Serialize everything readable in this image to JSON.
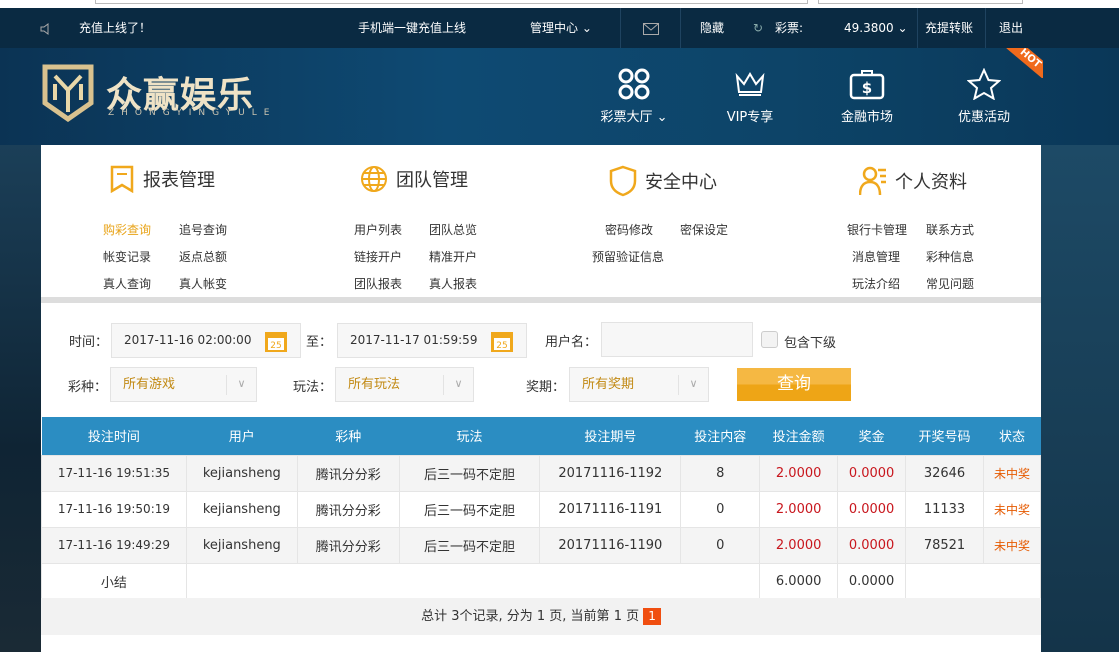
{
  "topbar": {
    "notice": "充值上线了！",
    "marquee": "手机端一键充值上线",
    "admin": "管理中心",
    "hide": "隐藏",
    "lottery_label": "彩票:",
    "balance": "49.3800",
    "transfer": "充提转账",
    "logout": "退出"
  },
  "header": {
    "logo_title": "众赢娱乐",
    "logo_sub": "ZHONGYINGYULE",
    "nav": [
      {
        "label": "彩票大厅"
      },
      {
        "label": "VIP专享"
      },
      {
        "label": "金融市场"
      },
      {
        "label": "优惠活动"
      }
    ],
    "hot_badge": "HOT"
  },
  "menu": {
    "categories": [
      {
        "title": "报表管理",
        "links": [
          "购彩查询",
          "追号查询",
          "帐变记录",
          "返点总额",
          "真人查询",
          "真人帐变"
        ]
      },
      {
        "title": "团队管理",
        "links": [
          "用户列表",
          "团队总览",
          "链接开户",
          "精准开户",
          "团队报表",
          "真人报表"
        ]
      },
      {
        "title": "安全中心",
        "links": [
          "密码修改",
          "密保设定",
          "预留验证信息"
        ]
      },
      {
        "title": "个人资料",
        "links": [
          "银行卡管理",
          "联系方式",
          "消息管理",
          "彩种信息",
          "玩法介绍",
          "常见问题"
        ]
      }
    ]
  },
  "filter": {
    "time_label": "时间：",
    "start": "2017-11-16 02:00:00",
    "to_label": "至：",
    "end": "2017-11-17 01:59:59",
    "cal_day": "25",
    "user_label": "用户名：",
    "username": "",
    "include_sub": "包含下级",
    "game_label": "彩种：",
    "game": "所有游戏",
    "play_label": "玩法：",
    "play": "所有玩法",
    "period_label": "奖期：",
    "period": "所有奖期",
    "query": "查询"
  },
  "table": {
    "headers": [
      "投注时间",
      "用户",
      "彩种",
      "玩法",
      "投注期号",
      "投注内容",
      "投注金额",
      "奖金",
      "开奖号码",
      "状态"
    ],
    "rows": [
      [
        "17-11-16 19:51:35",
        "kejiansheng",
        "腾讯分分彩",
        "后三一码不定胆",
        "20171116-1192",
        "8",
        "2.0000",
        "0.0000",
        "32646",
        "未中奖"
      ],
      [
        "17-11-16 19:50:19",
        "kejiansheng",
        "腾讯分分彩",
        "后三一码不定胆",
        "20171116-1191",
        "0",
        "2.0000",
        "0.0000",
        "11133",
        "未中奖"
      ],
      [
        "17-11-16 19:49:29",
        "kejiansheng",
        "腾讯分分彩",
        "后三一码不定胆",
        "20171116-1190",
        "0",
        "2.0000",
        "0.0000",
        "78521",
        "未中奖"
      ]
    ],
    "summary": {
      "label": "小结",
      "amount": "6.0000",
      "prize": "0.0000"
    }
  },
  "pager": {
    "text": "总计 3个记录, 分为 1 页, 当前第 1 页",
    "current": "1"
  }
}
